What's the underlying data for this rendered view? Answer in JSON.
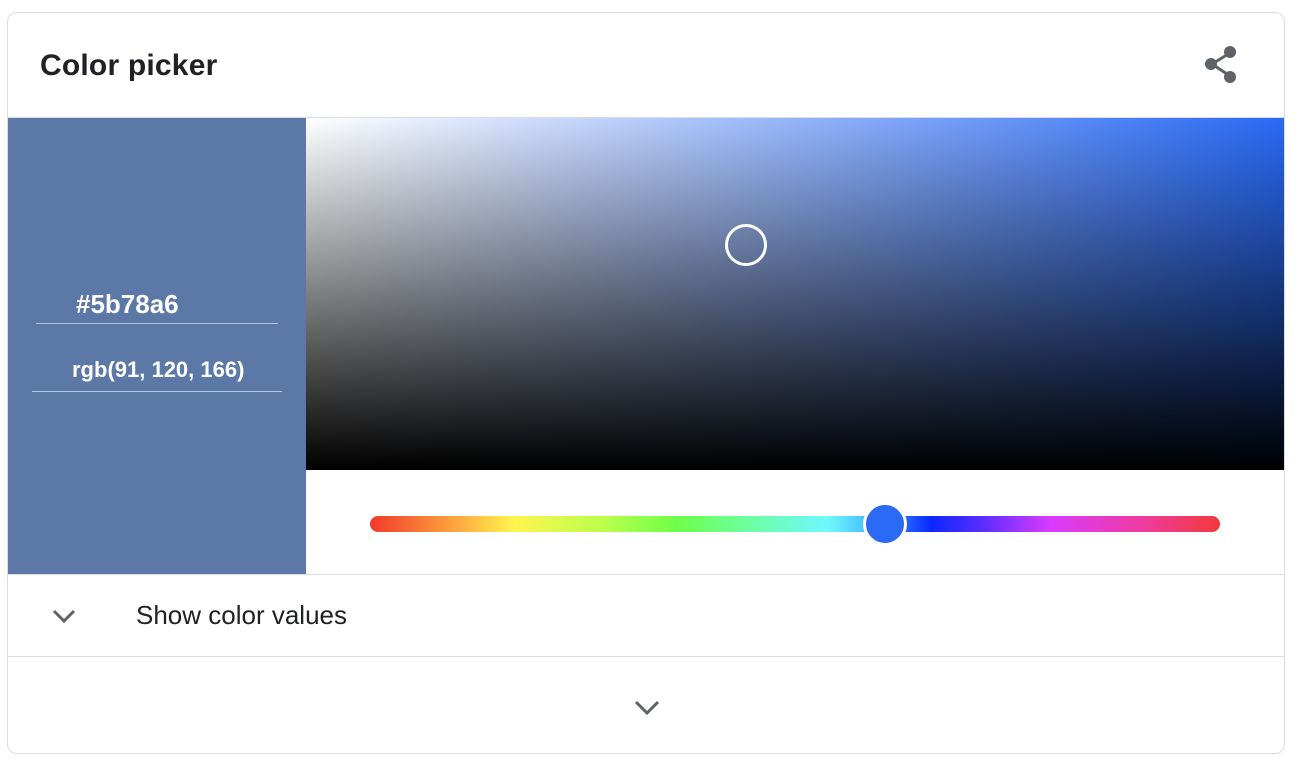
{
  "header": {
    "title": "Color picker",
    "share_icon": "share-icon"
  },
  "picker": {
    "selected_color": "#5b78a6",
    "hue_color": "#2a6af5",
    "hex_value": "#5b78a6",
    "rgb_value": "rgb(91, 120, 166)",
    "hue_position_percent": 60.6
  },
  "values_toggle": {
    "label": "Show color values",
    "icon": "chevron-down-icon"
  },
  "expand_more": {
    "icon": "chevron-down-icon"
  }
}
